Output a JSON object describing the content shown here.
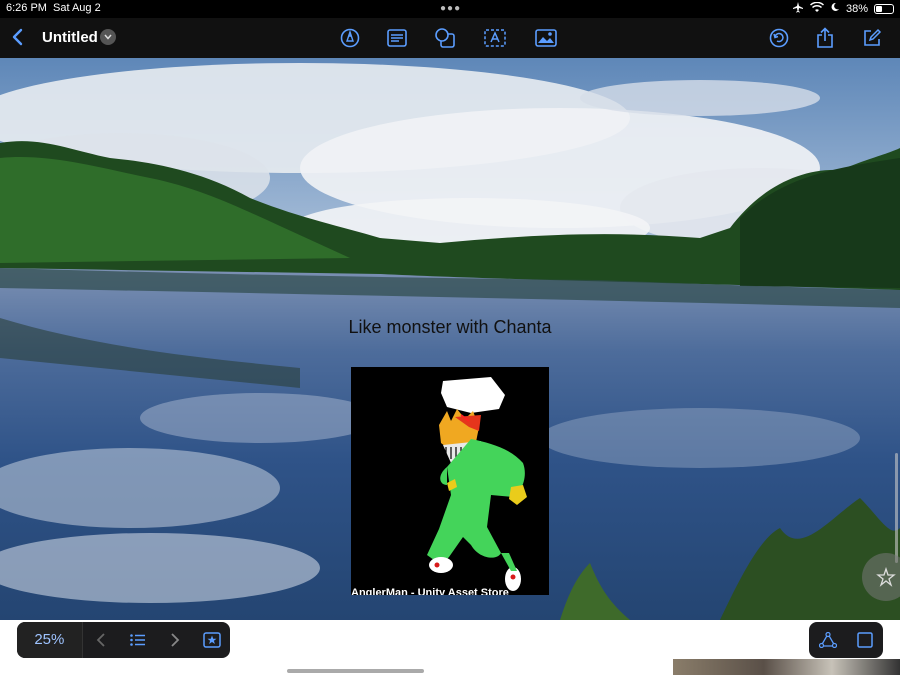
{
  "status_bar": {
    "time": "6:26 PM",
    "date": "Sat Aug 2",
    "battery": "38%",
    "battery_level": 0.38,
    "icons": [
      "airplane-icon",
      "wifi-icon",
      "moon-icon",
      "battery-icon"
    ]
  },
  "toolbar": {
    "title": "Untitled",
    "icons": [
      "back-icon",
      "title-menu-icon",
      "pen-icon",
      "text-box-icon",
      "shapes-icon",
      "text-frame-icon",
      "media-icon",
      "undo-icon",
      "share-icon",
      "compose-icon"
    ]
  },
  "canvas": {
    "caption": "Like monster with Chanta",
    "card_credit": "AnglerMan - Unity Asset Store"
  },
  "bottom_bar": {
    "zoom": "25%",
    "icons": [
      "previous-icon",
      "list-icon",
      "next-icon",
      "favorite-slide-icon",
      "shape-style-icon",
      "frame-icon"
    ]
  },
  "colors": {
    "accent": "#5b9dff",
    "toolbar_bg": "#111111",
    "monster_green": "#44d45a"
  }
}
